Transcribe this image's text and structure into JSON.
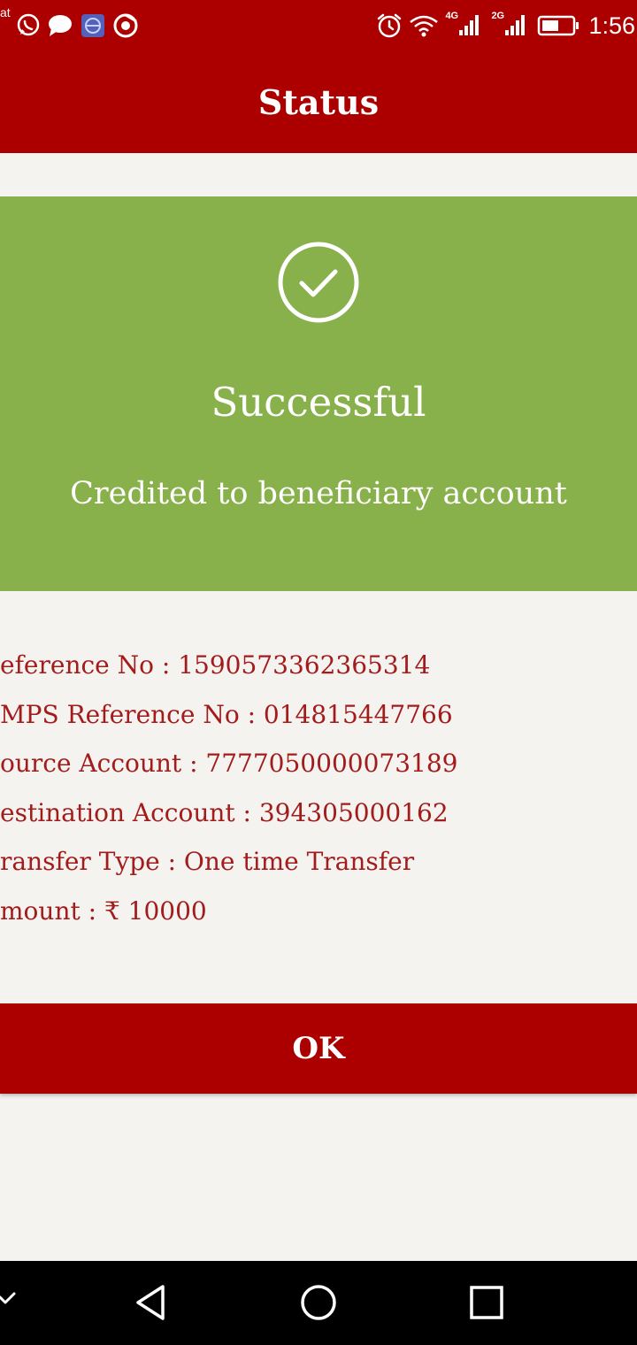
{
  "status_bar": {
    "left_text": "at",
    "time": "1:56",
    "icons": [
      "whatsapp-icon",
      "message-bubble-icon",
      "app-icon",
      "chrome-icon",
      "alarm-icon",
      "wifi-icon",
      "signal-4g-icon",
      "signal-2g-icon",
      "battery-icon"
    ],
    "net_4g": "4G",
    "net_2g": "2G"
  },
  "header": {
    "title": "Status"
  },
  "result": {
    "icon": "check-circle-icon",
    "title": "Successful",
    "subtitle": "Credited to beneficiary account",
    "color": "#88b04b"
  },
  "details": [
    "eference No : 1590573362365314",
    "MPS Reference No : 014815447766",
    "ource Account : 7777050000073189",
    "estination Account : 394305000162",
    "ransfer Type : One time Transfer",
    "mount : ₹ 10000"
  ],
  "actions": {
    "ok_label": "OK"
  },
  "nav_bar": {
    "icons": [
      "hide-nav-icon",
      "back-icon",
      "home-icon",
      "recents-icon"
    ]
  },
  "colors": {
    "brand": "#ac0000",
    "success": "#88b04b",
    "detail_text": "#a21c1c",
    "background": "#f5f3f0"
  }
}
